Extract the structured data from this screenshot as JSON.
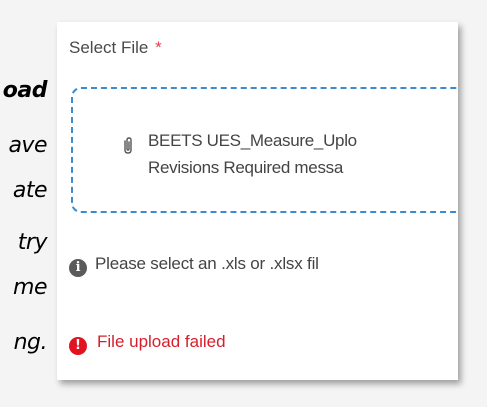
{
  "background_text": {
    "lines": [
      "oad",
      "ave",
      "ate",
      "try",
      "me",
      "ng."
    ]
  },
  "form": {
    "field_label": "Select File",
    "required_marker": "*",
    "dropzone": {
      "file_name": "BEETS UES_Measure_Uplo",
      "file_message": "Revisions Required messa"
    },
    "hint": "Please select an .xls or .xlsx fil",
    "error": "File upload failed"
  },
  "colors": {
    "accent_blue": "#3b8bd1",
    "error_red": "#e1131e",
    "required_red": "#e0424a"
  },
  "icons": {
    "attachment": "paperclip-icon",
    "info": "info-icon",
    "error": "error-icon"
  }
}
